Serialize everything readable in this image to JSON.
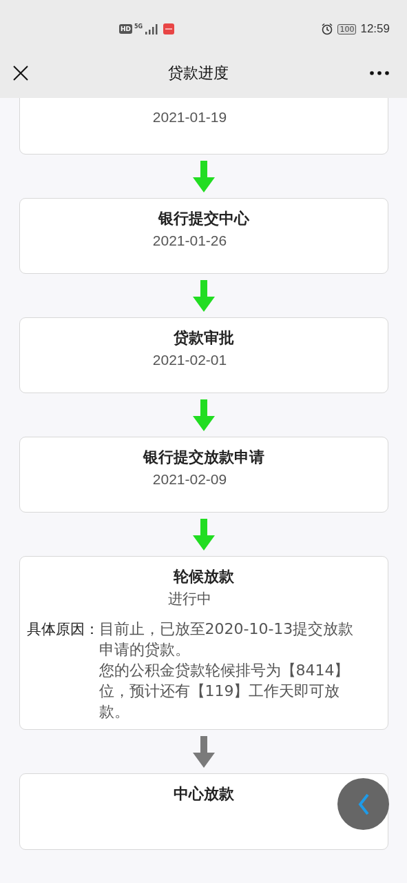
{
  "status_bar": {
    "time": "12:59",
    "battery": "100",
    "hd_label": "HD",
    "network": "5G"
  },
  "header": {
    "title": "贷款进度"
  },
  "steps": [
    {
      "kind": "date",
      "date": "2021-01-19",
      "cut_top": true
    },
    {
      "kind": "date",
      "title": "银行提交中心",
      "date": "2021-01-26",
      "arrow_active": true
    },
    {
      "kind": "date",
      "title": "贷款审批",
      "date": "2021-02-01",
      "arrow_active": true
    },
    {
      "kind": "date",
      "title": "银行提交放款申请",
      "date": "2021-02-09",
      "arrow_active": true
    },
    {
      "kind": "detail",
      "title": "轮候放款",
      "status": "进行中",
      "reason_label": "具体原因：",
      "reason_lines": [
        "目前止，已放至2020-10-13提交放款申请的贷款。",
        "您的公积金贷款轮候排号为【8414】位，预计还有【119】工作天即可放款。"
      ],
      "arrow_active": true
    },
    {
      "kind": "empty",
      "title": "中心放款",
      "arrow_active": false
    }
  ]
}
